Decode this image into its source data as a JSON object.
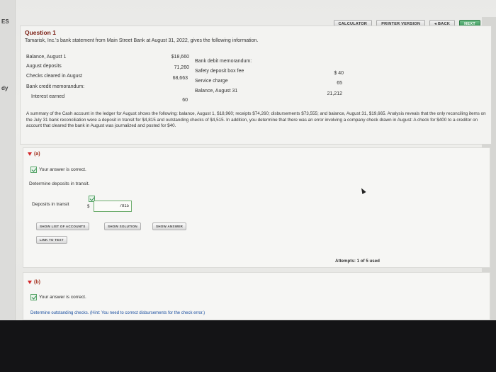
{
  "left_labels": [
    "ES",
    "dy"
  ],
  "toolbar": {
    "calculator": "CALCULATOR",
    "printer": "PRINTER VERSION",
    "back": "◂ BACK",
    "next": "NEXT"
  },
  "question": {
    "title": "Question 1",
    "intro": "Tamarisk, Inc.'s bank statement from Main Street Bank at August 31, 2022, gives the following information.",
    "left_items": [
      {
        "label": "Balance, August 1",
        "value": "$18,660"
      },
      {
        "label": "August deposits",
        "value": "71,260"
      },
      {
        "label": "Checks cleared in August",
        "value": "68,663"
      },
      {
        "label": "Bank credit memorandum:",
        "value": ""
      },
      {
        "label": "Interest earned",
        "value": "60"
      }
    ],
    "right_items": [
      {
        "label": "Bank debit memorandum:",
        "value": ""
      },
      {
        "label": "Safety deposit box fee",
        "value": "$ 40"
      },
      {
        "label": "Service charge",
        "value": "65"
      },
      {
        "label": "Balance, August 31",
        "value": "21,212"
      }
    ],
    "summary": "A summary of the Cash account in the ledger for August shows the following: balance, August 1, $18,960; receipts $74,260; disbursements $73,555; and balance, August 31, $19,665. Analysis reveals that the only reconciling items on the July 31 bank reconciliation were a deposit in transit for $4,815 and outstanding checks of $4,515. In addition, you determine that there was an error involving a company check drawn in August: A check for $400 to a creditor on account that cleared the bank in August was journalized and posted for $40."
  },
  "part_a": {
    "label": "(a)",
    "correct_msg": "Your answer is correct.",
    "instruction": "Determine deposits in transit.",
    "field_label": "Deposits in transit",
    "currency": "$",
    "field_value": "7815",
    "buttons": {
      "show_list": "SHOW LIST OF ACCOUNTS",
      "show_solution": "SHOW SOLUTION",
      "show_answer": "SHOW ANSWER",
      "link_to_text": "LINK TO TEXT"
    },
    "attempts": "Attempts: 1 of 5 used"
  },
  "part_b": {
    "label": "(b)",
    "correct_msg": "Your answer is correct.",
    "instruction_cut": "Determine outstanding checks. (Hint: You need to correct disbursements for the check error.)"
  }
}
